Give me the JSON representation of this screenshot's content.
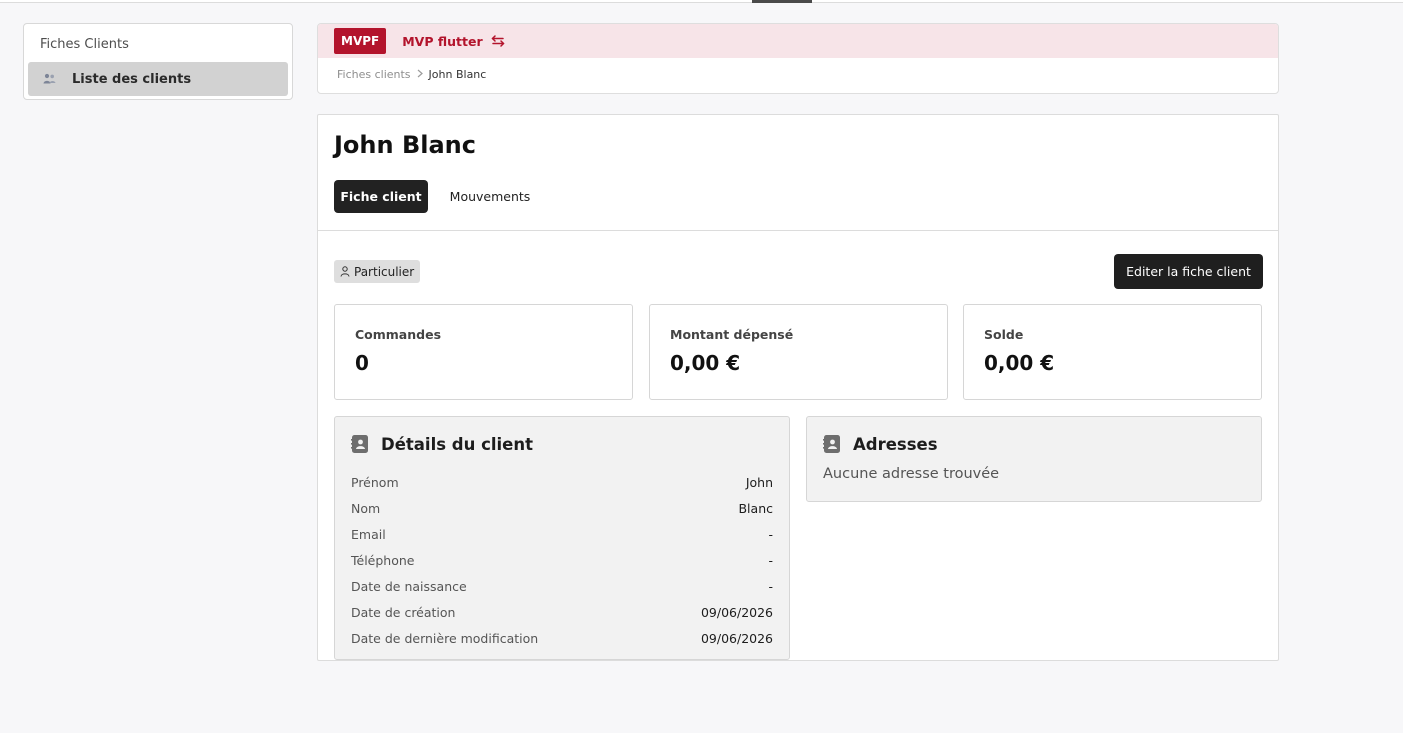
{
  "sidebar": {
    "title": "Fiches Clients",
    "items": [
      {
        "label": "Liste des clients",
        "icon": "users-icon"
      }
    ]
  },
  "header": {
    "badge": "MVPF",
    "project": "MVP flutter",
    "breadcrumb": [
      "Fiches clients",
      "John Blanc"
    ]
  },
  "client": {
    "name": "John Blanc",
    "tabs": [
      {
        "label": "Fiche client",
        "active": true
      },
      {
        "label": "Mouvements",
        "active": false
      }
    ],
    "type_tag": "Particulier",
    "edit_label": "Editer la fiche client",
    "stats": [
      {
        "label": "Commandes",
        "value": "0"
      },
      {
        "label": "Montant dépensé",
        "value": "0,00 €"
      },
      {
        "label": "Solde",
        "value": "0,00 €"
      }
    ],
    "details": {
      "title": "Détails du client",
      "rows": [
        {
          "key": "Prénom",
          "value": "John"
        },
        {
          "key": "Nom",
          "value": "Blanc"
        },
        {
          "key": "Email",
          "value": "-"
        },
        {
          "key": "Téléphone",
          "value": "-"
        },
        {
          "key": "Date de naissance",
          "value": "-"
        },
        {
          "key": "Date de création",
          "value": "09/06/2026"
        },
        {
          "key": "Date de dernière modification",
          "value": "09/06/2026"
        }
      ]
    },
    "addresses": {
      "title": "Adresses",
      "empty": "Aucune adresse trouvée"
    }
  },
  "colors": {
    "brand": "#b3142c",
    "brand_band": "#f7e4e8",
    "primary_button": "#1f1f1f"
  }
}
